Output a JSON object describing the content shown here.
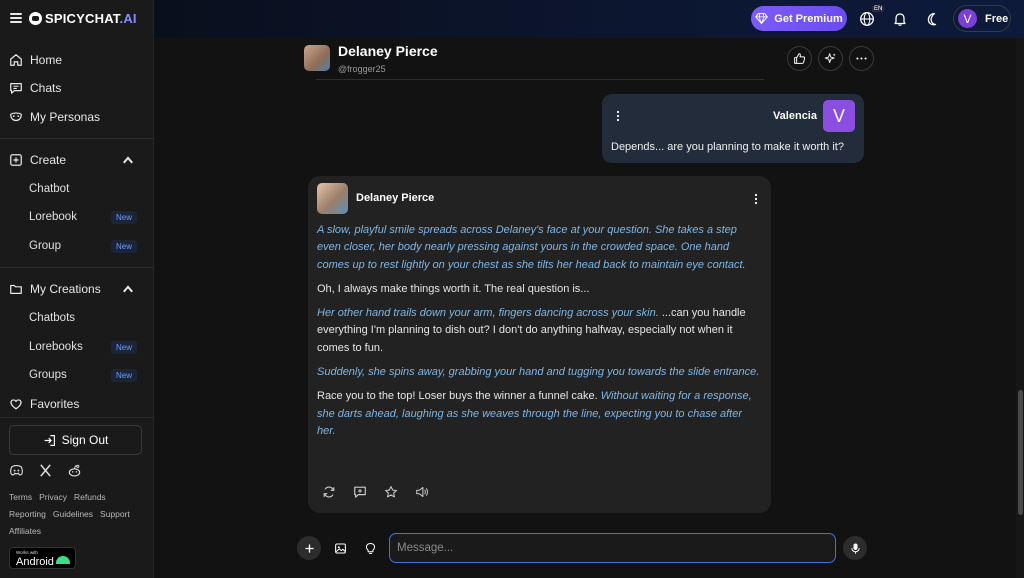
{
  "brand": {
    "name": "SPICYCHAT",
    "suffix": ".AI"
  },
  "sidebar": {
    "main": [
      {
        "label": "Home",
        "icon": "home-icon"
      },
      {
        "label": "Chats",
        "icon": "chat-icon"
      },
      {
        "label": "My Personas",
        "icon": "mask-icon"
      }
    ],
    "create": {
      "label": "Create",
      "items": [
        {
          "label": "Chatbot",
          "badge": ""
        },
        {
          "label": "Lorebook",
          "badge": "New"
        },
        {
          "label": "Group",
          "badge": "New"
        }
      ]
    },
    "creations": {
      "label": "My Creations",
      "items": [
        {
          "label": "Chatbots",
          "badge": ""
        },
        {
          "label": "Lorebooks",
          "badge": "New"
        },
        {
          "label": "Groups",
          "badge": "New"
        }
      ]
    },
    "favorites": "Favorites",
    "sign_out": "Sign Out",
    "footer": {
      "row1": [
        "Terms",
        "Privacy",
        "Refunds"
      ],
      "row2": [
        "Reporting",
        "Guidelines",
        "Support"
      ],
      "row3": [
        "Affiliates"
      ]
    },
    "android_badge": {
      "small": "Works with",
      "big": "Android"
    }
  },
  "topbar": {
    "premium_label": "Get Premium",
    "lang": "EN",
    "user_initial": "V",
    "plan": "Free"
  },
  "character": {
    "name": "Delaney Pierce",
    "handle": "@frogger25"
  },
  "messages": {
    "user": {
      "name": "Valencia",
      "initial": "V",
      "text": "Depends... are you planning to make it worth it?"
    },
    "bot": {
      "name": "Delaney Pierce",
      "p1_action": "A slow, playful smile spreads across Delaney's face at your question. She takes a step even closer, her body nearly pressing against yours in the crowded space. One hand comes up to rest lightly on your chest as she tilts her head back to maintain eye contact.",
      "p2": "Oh, I always make things worth it. The real question is...",
      "p3_action": "Her other hand trails down your arm, fingers dancing across your skin.",
      "p3_speech": " ...can you handle everything I'm planning to dish out? I don't do anything halfway, especially not when it comes to fun.",
      "p4_action": "Suddenly, she spins away, grabbing your hand and tugging you towards the slide entrance.",
      "p5_speech": "Race you to the top! Loser buys the winner a funnel cake. ",
      "p5_action": "Without waiting for a response, she darts ahead, laughing as she weaves through the line, expecting you to chase after her."
    }
  },
  "composer": {
    "placeholder": "Message..."
  },
  "colors": {
    "accent": "#7c5cf6",
    "action_text": "#7fb6e6",
    "input_border": "#3b73e0"
  }
}
